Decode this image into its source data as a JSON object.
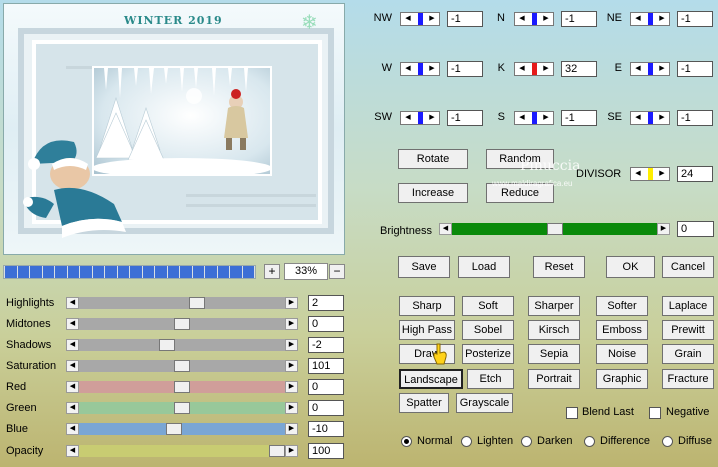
{
  "preview": {
    "title": "WINTER 2019"
  },
  "zoom": {
    "plus": "+",
    "minus": "−",
    "value": "33%"
  },
  "progress": {
    "segments": 20,
    "fraction": 1.0
  },
  "sliders": [
    {
      "label": "Highlights",
      "value": "2",
      "position": 0.58,
      "color": "#a8a8a8"
    },
    {
      "label": "Midtones",
      "value": "0",
      "position": 0.5,
      "color": "#a8a8a8"
    },
    {
      "label": "Shadows",
      "value": "-2",
      "position": 0.42,
      "color": "#a8a8a8"
    },
    {
      "label": "Saturation",
      "value": "101",
      "position": 0.5,
      "color": "#a8a8a8"
    },
    {
      "label": "Red",
      "value": "0",
      "position": 0.5,
      "color": "#d09e9a"
    },
    {
      "label": "Green",
      "value": "0",
      "position": 0.5,
      "color": "#98c89a"
    },
    {
      "label": "Blue",
      "value": "-10",
      "position": 0.46,
      "color": "#7aa6d4"
    },
    {
      "label": "Opacity",
      "value": "100",
      "position": 1.0,
      "color": "#c8cc72"
    }
  ],
  "kernel": [
    {
      "label": "NW",
      "value": "-1",
      "marker": "#1a1aff"
    },
    {
      "label": "N",
      "value": "-1",
      "marker": "#1a1aff"
    },
    {
      "label": "NE",
      "value": "-1",
      "marker": "#1a1aff"
    },
    {
      "label": "W",
      "value": "-1",
      "marker": "#1a1aff"
    },
    {
      "label": "K",
      "value": "32",
      "marker": "#e61a1a"
    },
    {
      "label": "E",
      "value": "-1",
      "marker": "#1a1aff"
    },
    {
      "label": "SW",
      "value": "-1",
      "marker": "#1a1aff"
    },
    {
      "label": "S",
      "value": "-1",
      "marker": "#1a1aff"
    },
    {
      "label": "SE",
      "value": "-1",
      "marker": "#1a1aff"
    }
  ],
  "ops": {
    "rotate": "Rotate",
    "random": "Random",
    "increase": "Increase",
    "reduce": "Reduce"
  },
  "watermark": {
    "name": "Pinuccia",
    "site": "www.maldiragrafica.eu"
  },
  "divisor": {
    "label": "DIVISOR",
    "value": "24",
    "marker": "#ffee00"
  },
  "brightness": {
    "label": "Brightness",
    "value": "0",
    "position": 0.5,
    "color": "#0a8a0a"
  },
  "actions": {
    "save": "Save",
    "load": "Load",
    "reset": "Reset",
    "ok": "OK",
    "cancel": "Cancel"
  },
  "presets": [
    [
      "Sharp",
      "Soft",
      "Sharper",
      "Softer",
      "Laplace"
    ],
    [
      "High Pass",
      "Sobel",
      "Kirsch",
      "Emboss",
      "Prewitt"
    ],
    [
      "Draw",
      "Posterize",
      "Sepia",
      "Noise",
      "Grain"
    ],
    [
      "Landscape",
      "Etch",
      "Portrait",
      "Graphic",
      "Fracture"
    ],
    [
      "Spatter",
      "Grayscale"
    ]
  ],
  "checkboxes": {
    "blend_last": "Blend Last",
    "negative": "Negative"
  },
  "modes": [
    "Normal",
    "Lighten",
    "Darken",
    "Difference",
    "Diffuse"
  ],
  "selected_mode": "Normal"
}
